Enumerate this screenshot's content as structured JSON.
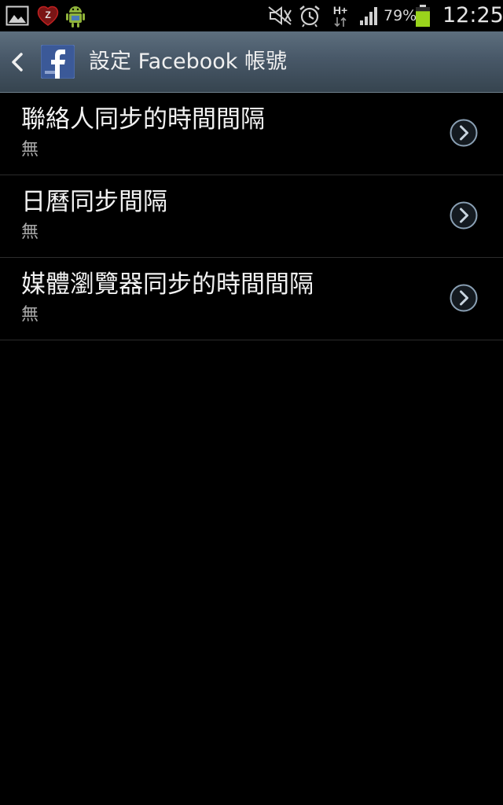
{
  "status_bar": {
    "icons": [
      "gallery-icon",
      "zedge-icon",
      "android-robot-icon",
      "mute-icon",
      "alarm-icon",
      "hplus-network-icon",
      "signal-icon",
      "battery-icon"
    ],
    "network_label": "H+",
    "battery_percent": "79%",
    "battery_level": 0.79,
    "time": "12:25"
  },
  "action_bar": {
    "title": "設定 Facebook 帳號",
    "app_icon": "facebook-icon",
    "colors": {
      "accent": "#3b5998"
    }
  },
  "settings": {
    "items": [
      {
        "title": "聯絡人同步的時間間隔",
        "summary": "無"
      },
      {
        "title": "日曆同步間隔",
        "summary": "無"
      },
      {
        "title": "媒體瀏覽器同步的時間間隔",
        "summary": "無"
      }
    ]
  }
}
